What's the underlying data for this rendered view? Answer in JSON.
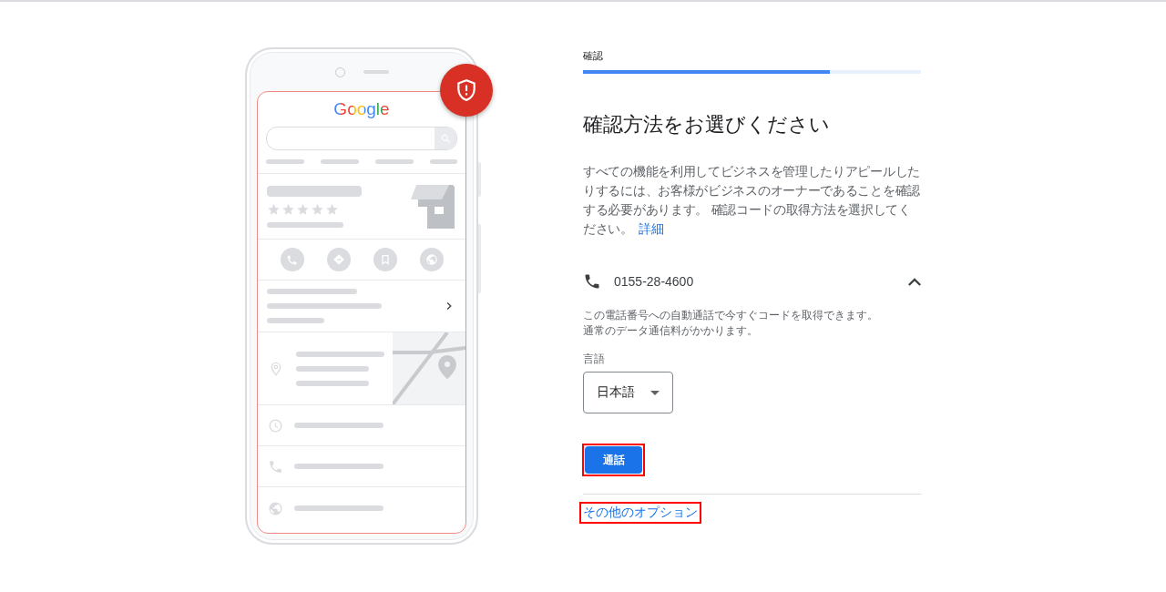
{
  "phone_illustration": {
    "logo": "Google"
  },
  "step": {
    "label": "確認",
    "level": 0.73
  },
  "title": "確認方法をお選びください",
  "description": "すべての機能を利用してビジネスを管理したりアピールしたりするには、お客様がビジネスのオーナーであることを確認する必要があります。 確認コードの取得方法を選択してください。",
  "details_link": "詳細",
  "method": {
    "phone": "0155-28-4600",
    "expanded": true,
    "info_lines": [
      "この電話番号への自動通話で今すぐコードを取得できます。",
      "通常のデータ通信料がかかります。"
    ],
    "language_label": "言語",
    "language_value": "日本語",
    "call_button": {
      "label": "通話",
      "highlighted": true
    }
  },
  "other_options": {
    "label": "その他のオプション",
    "highlighted": true
  }
}
